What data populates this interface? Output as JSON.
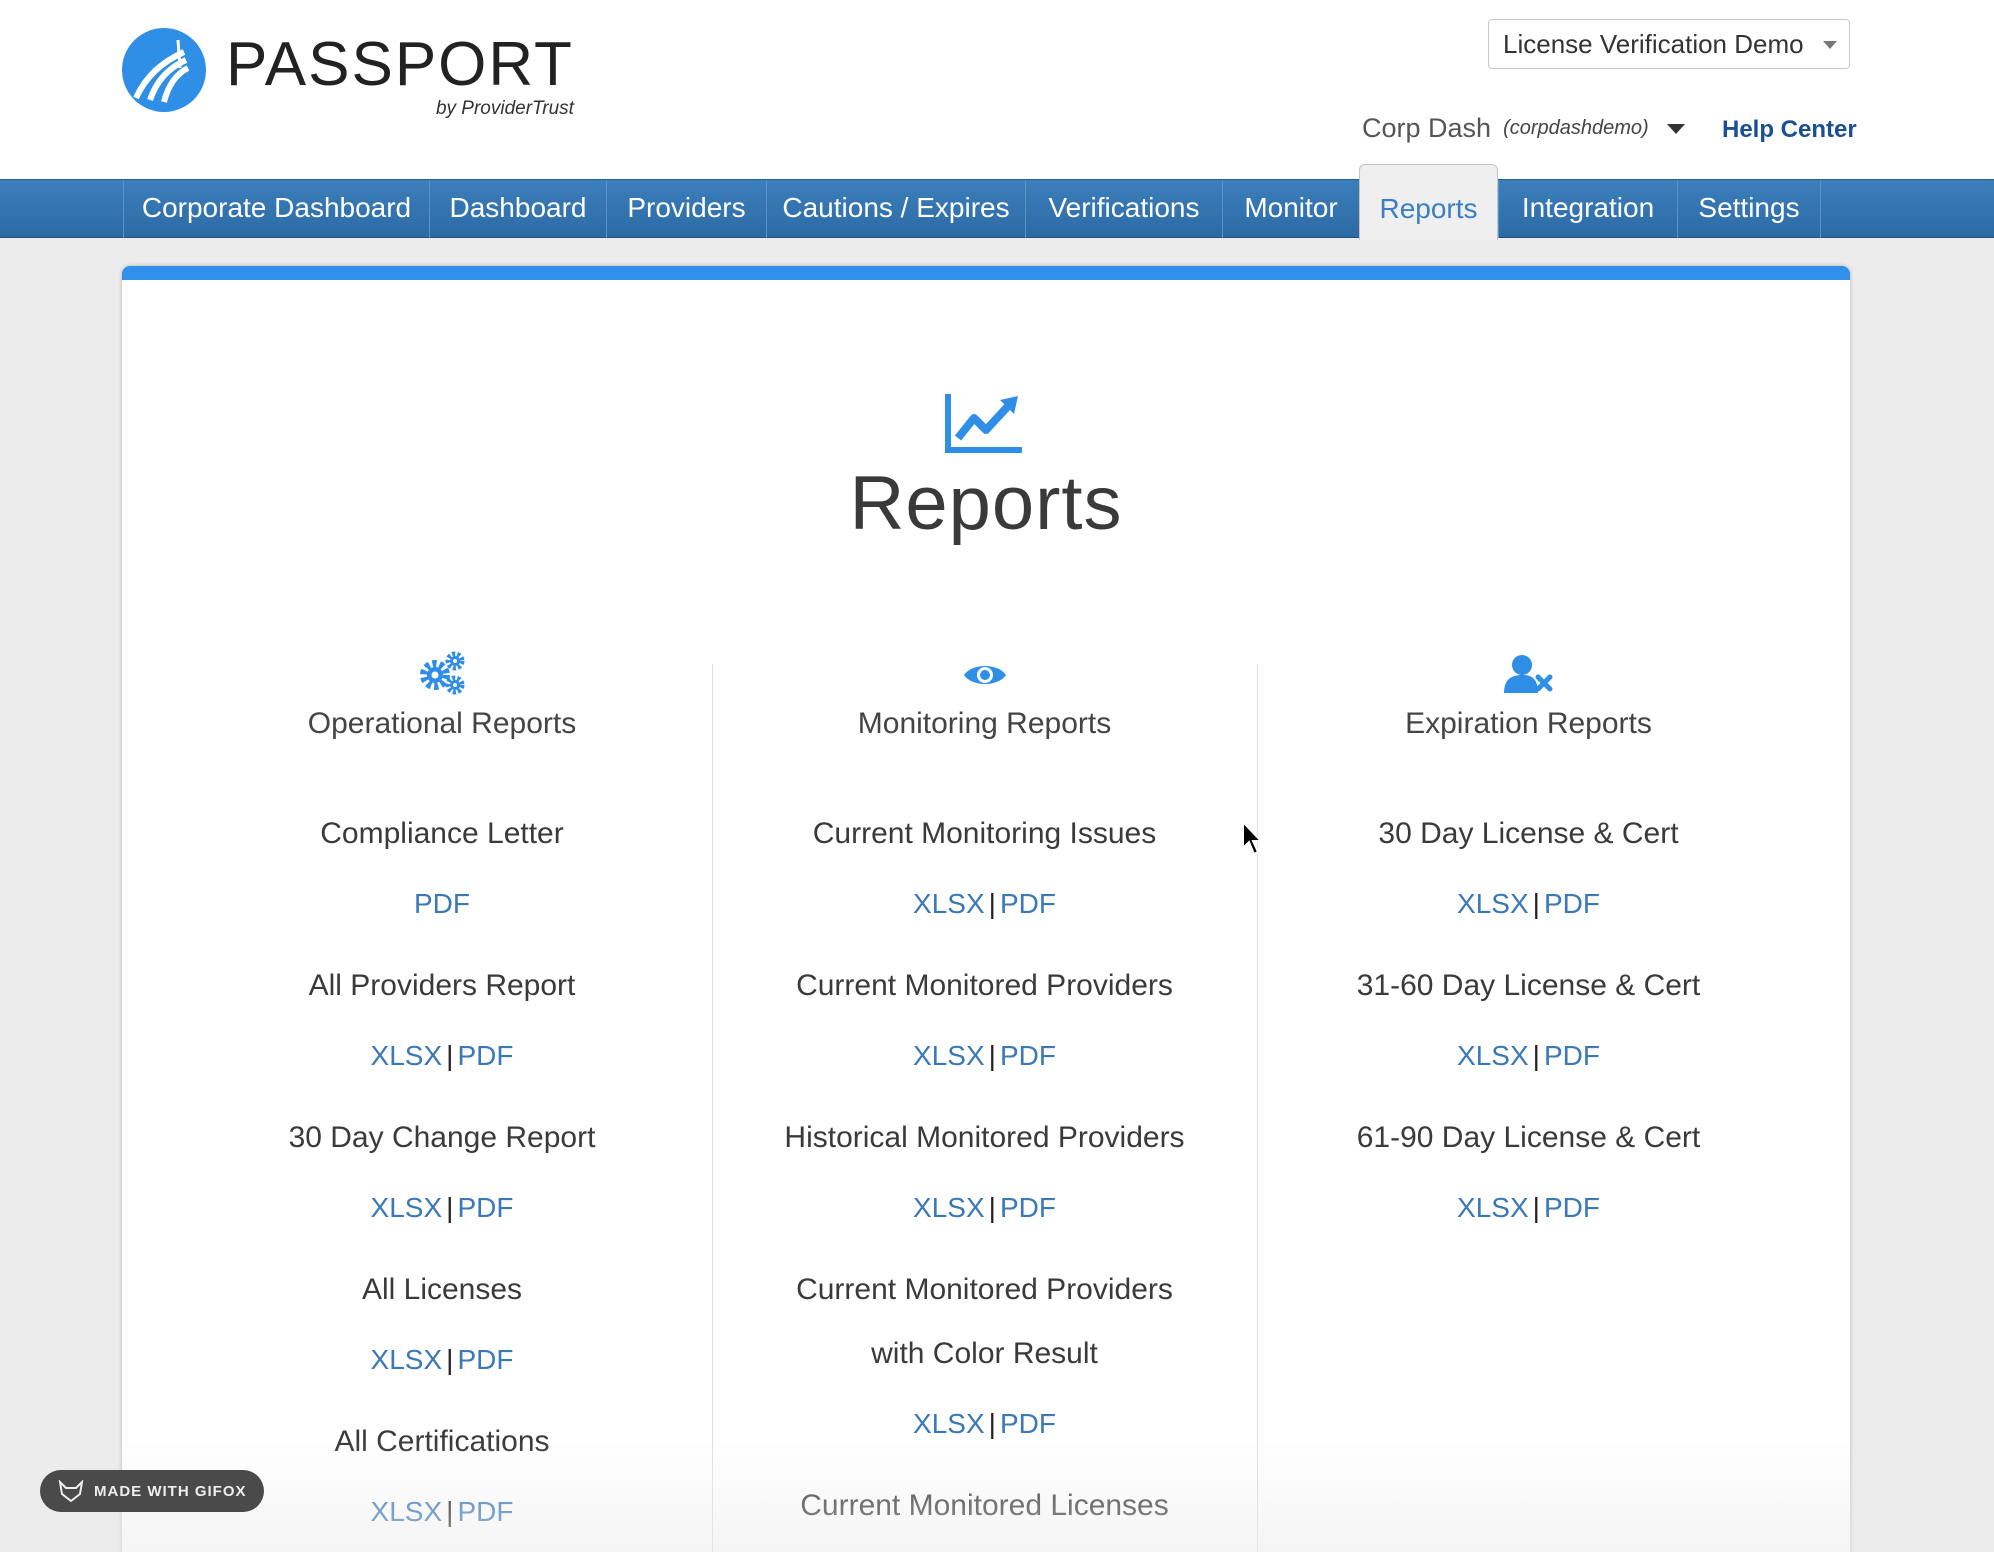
{
  "brand": {
    "name": "PASSPORT",
    "tagline": "by ProviderTrust",
    "color": "#2f8ee6"
  },
  "org_select": {
    "value": "License Verification Demo"
  },
  "user": {
    "name": "Corp Dash",
    "id": "(corpdashdemo)"
  },
  "help": {
    "label": "Help Center"
  },
  "nav": {
    "tabs": [
      {
        "label": "Corporate Dashboard"
      },
      {
        "label": "Dashboard"
      },
      {
        "label": "Providers"
      },
      {
        "label": "Cautions / Expires"
      },
      {
        "label": "Verifications"
      },
      {
        "label": "Monitor"
      },
      {
        "label": "Reports",
        "active": true
      },
      {
        "label": "Integration"
      },
      {
        "label": "Settings"
      }
    ]
  },
  "page": {
    "title": "Reports",
    "icon": "chart-line-icon",
    "accent": "#3090ea"
  },
  "columns": [
    {
      "title": "Operational Reports",
      "icon": "gears-icon",
      "reports": [
        {
          "name": "Compliance Letter",
          "pdf": "PDF"
        },
        {
          "name": "All Providers Report",
          "xlsx": "XLSX",
          "pdf": "PDF"
        },
        {
          "name": "30 Day Change Report",
          "xlsx": "XLSX",
          "pdf": "PDF"
        },
        {
          "name": "All Licenses",
          "xlsx": "XLSX",
          "pdf": "PDF"
        },
        {
          "name": "All Certifications",
          "xlsx": "XLSX",
          "pdf": "PDF"
        }
      ]
    },
    {
      "title": "Monitoring Reports",
      "icon": "eye-icon",
      "reports": [
        {
          "name": "Current Monitoring Issues",
          "xlsx": "XLSX",
          "pdf": "PDF"
        },
        {
          "name": "Current Monitored Providers",
          "xlsx": "XLSX",
          "pdf": "PDF"
        },
        {
          "name": "Historical Monitored Providers",
          "xlsx": "XLSX",
          "pdf": "PDF"
        },
        {
          "name_line1": "Current Monitored Providers",
          "name_line2": "with Color Result",
          "xlsx": "XLSX",
          "pdf": "PDF"
        },
        {
          "name": "Current Monitored Licenses"
        }
      ]
    },
    {
      "title": "Expiration Reports",
      "icon": "user-times-icon",
      "reports": [
        {
          "name": "30 Day License & Cert",
          "xlsx": "XLSX",
          "pdf": "PDF"
        },
        {
          "name": "31-60 Day License & Cert",
          "xlsx": "XLSX",
          "pdf": "PDF"
        },
        {
          "name": "61-90 Day License & Cert",
          "xlsx": "XLSX",
          "pdf": "PDF"
        }
      ]
    }
  ],
  "watermark": {
    "label": "MADE WITH GIFOX"
  },
  "colors": {
    "link": "#3a78b8",
    "nav": "#2c6aa5",
    "help": "#1a4f94"
  }
}
